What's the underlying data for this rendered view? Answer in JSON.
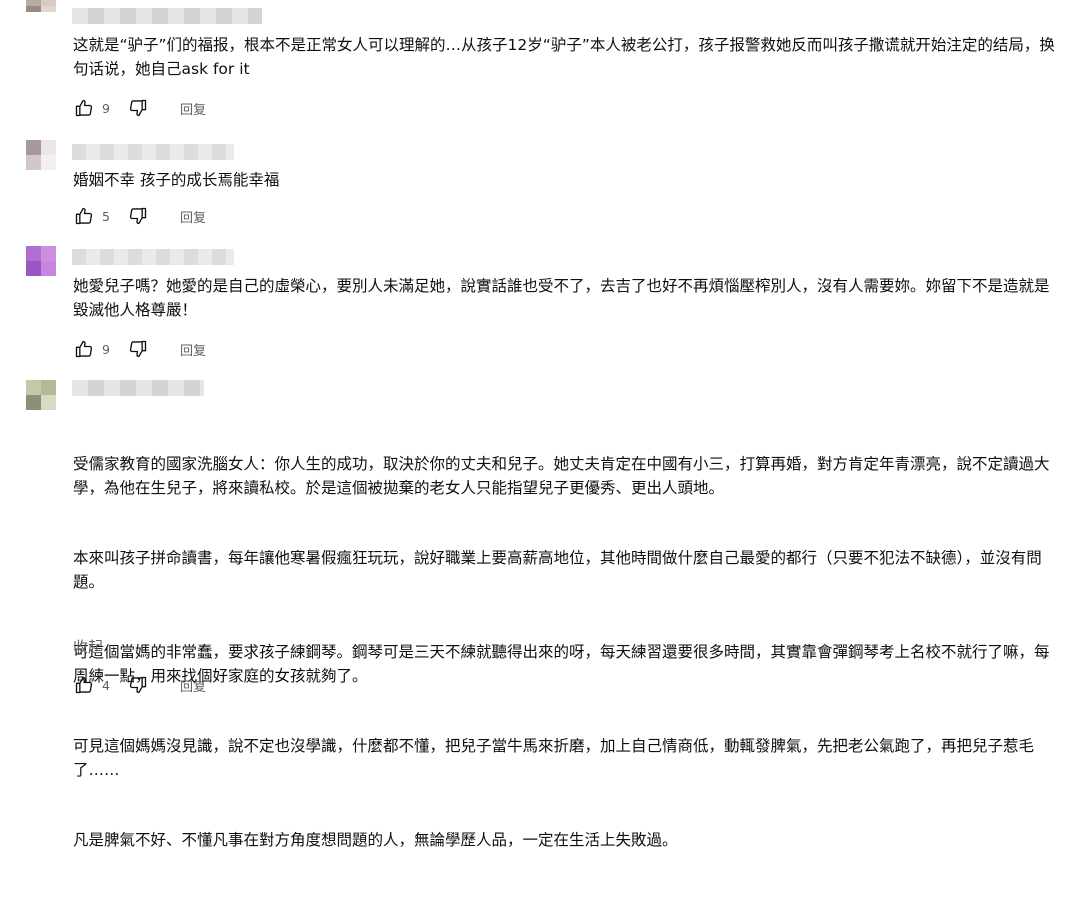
{
  "comments": [
    {
      "text": "这就是“驴子”们的福报，根本不是正常女人可以理解的…从孩子12岁“驴子”本人被老公打，孩子报警救她反而叫孩子撒谎就开始注定的结局，换句话说，她自己ask for it",
      "likes": "9",
      "reply_label": "回复"
    },
    {
      "text": "婚姻不幸 孩子的成长焉能幸福",
      "likes": "5",
      "reply_label": "回复"
    },
    {
      "text": "她愛兒子嗎？她愛的是自己的虛榮心，要別人未滿足她，說實話誰也受不了，去吉了也好不再煩惱壓榨別人，沒有人需要妳。妳留下不是造就是毀滅他人格尊嚴！",
      "likes": "9",
      "reply_label": "回复"
    },
    {
      "paragraphs": [
        "受儒家教育的國家洗腦女人：你人生的成功，取決於你的丈夫和兒子。她丈夫肯定在中國有小三，打算再婚，對方肯定年青漂亮，說不定讀過大學，為他在生兒子，將來讀私校。於是這個被拋棄的老女人只能指望兒子更優秀、更出人頭地。",
        "本來叫孩子拼命讀書，每年讓他寒暑假瘋狂玩玩，說好職業上要高薪高地位，其他時間做什麼自己最愛的都行（只要不犯法不缺德），並沒有問題。",
        "可這個當媽的非常蠢，要求孩子練鋼琴。鋼琴可是三天不練就聽得出來的呀，每天練習還要很多時間，其實靠會彈鋼琴考上名校不就行了嘛，每周練一點，用來找個好家庭的女孩就夠了。",
        "可見這個媽媽沒見識，說不定也沒學識，什麼都不懂，把兒子當牛馬來折磨，加上自己情商低，動輒發脾氣，先把老公氣跑了，再把兒子惹毛了……",
        "凡是脾氣不好、不懂凡事在對方角度想問題的人，無論學歷人品，一定在生活上失敗過。"
      ],
      "collapse_label": "收起",
      "likes": "4",
      "reply_label": "回复"
    }
  ],
  "colors": {
    "text": "#0f0f0f",
    "secondary": "#606060"
  },
  "icons": {
    "like": "thumb-up-icon",
    "dislike": "thumb-down-icon"
  }
}
